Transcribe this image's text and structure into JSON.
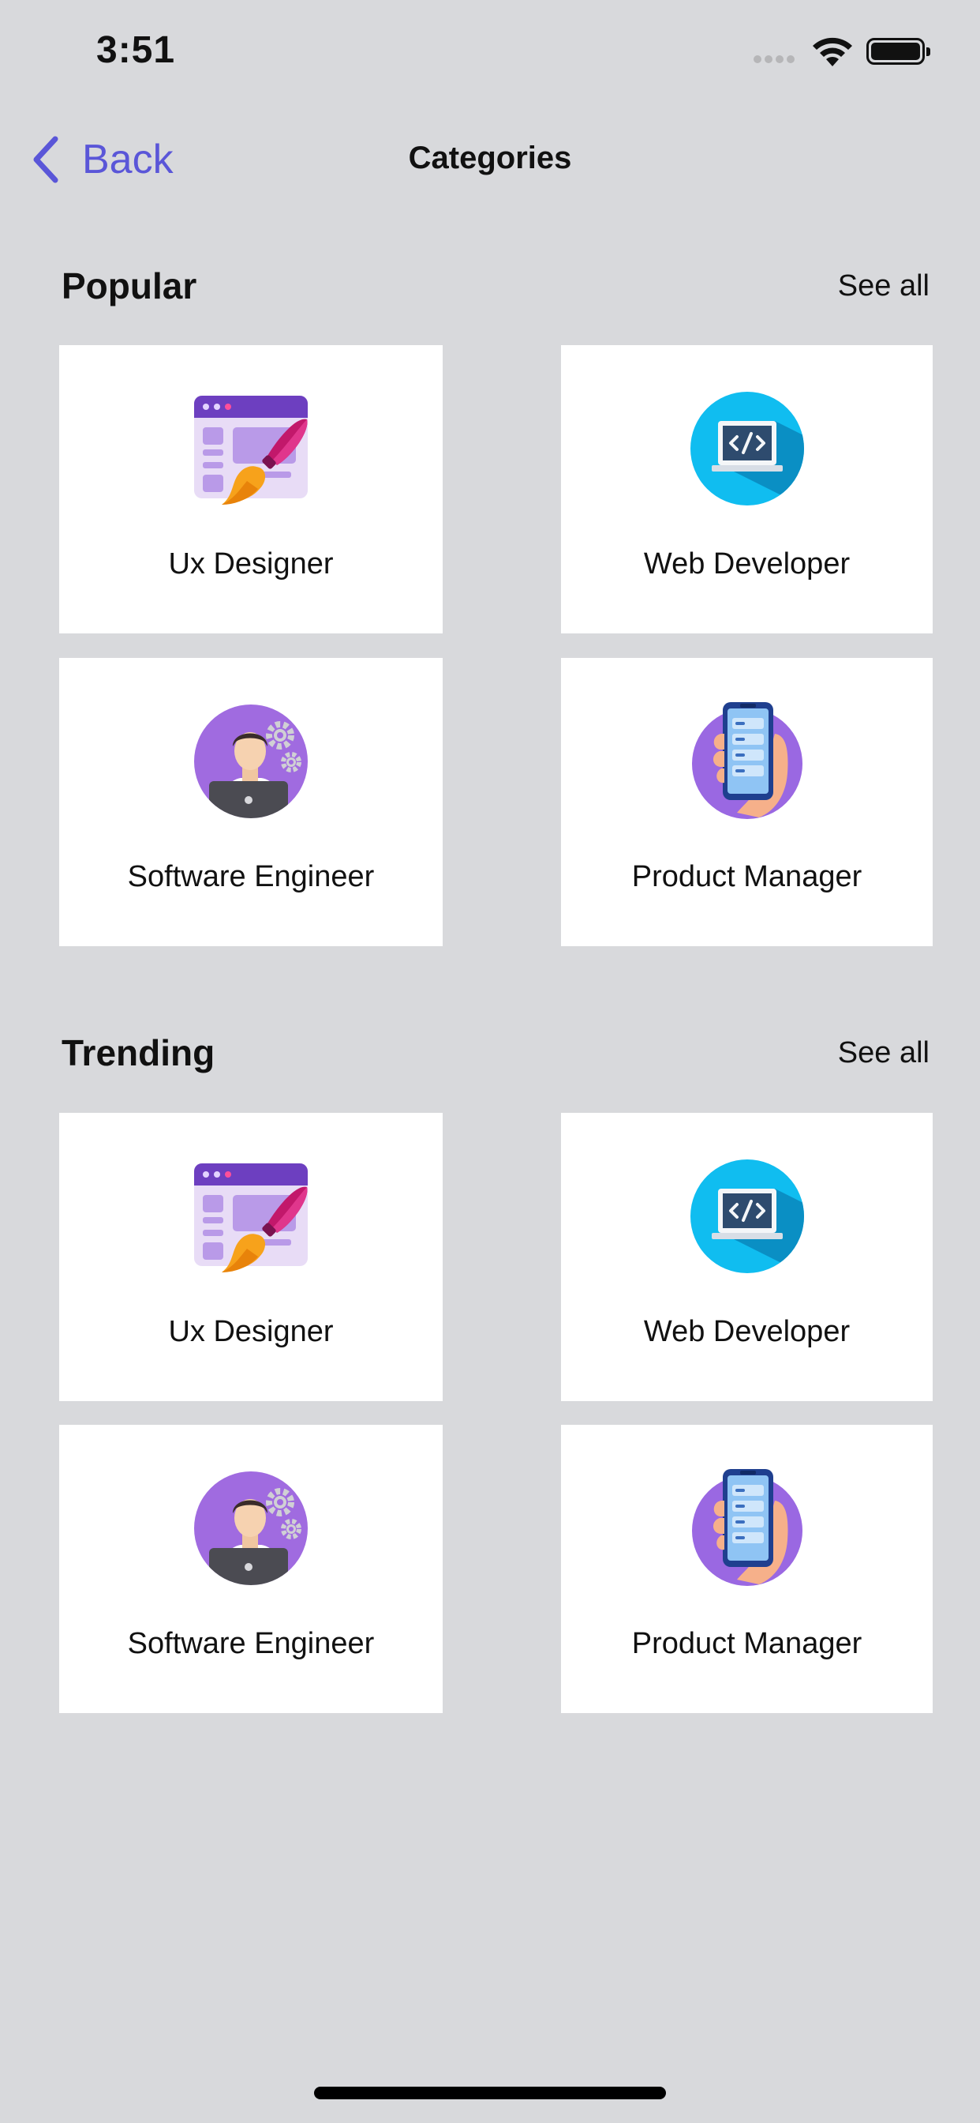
{
  "status_bar": {
    "time": "3:51"
  },
  "nav": {
    "back_label": "Back",
    "title": "Categories"
  },
  "sections": [
    {
      "title": "Popular",
      "see_all": "See all",
      "cards": [
        {
          "label": "Ux Designer",
          "icon": "ux-designer-icon"
        },
        {
          "label": "Web Developer",
          "icon": "web-developer-icon"
        },
        {
          "label": "Software Engineer",
          "icon": "software-engineer-icon"
        },
        {
          "label": "Product Manager",
          "icon": "product-manager-icon"
        }
      ]
    },
    {
      "title": "Trending",
      "see_all": "See all",
      "cards": [
        {
          "label": "Ux Designer",
          "icon": "ux-designer-icon"
        },
        {
          "label": "Web Developer",
          "icon": "web-developer-icon"
        },
        {
          "label": "Software Engineer",
          "icon": "software-engineer-icon"
        },
        {
          "label": "Product Manager",
          "icon": "product-manager-icon"
        }
      ]
    }
  ],
  "colors": {
    "accent": "#5a56d8",
    "background": "#d8d9dc",
    "card": "#ffffff"
  }
}
